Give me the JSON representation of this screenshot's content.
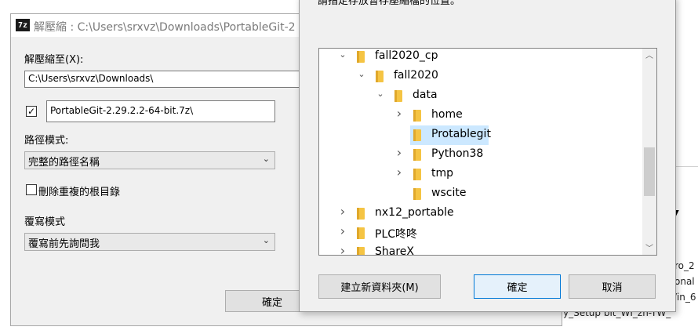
{
  "background": {
    "fragments": [
      "ro_2",
      "onal",
      "Vin_6",
      "y_Setup    bit_WI_zh-TW_"
    ]
  },
  "extract_dialog": {
    "logo": "7z",
    "title": "解壓縮 : C:\\Users\\srxvz\\Downloads\\PortableGit-2",
    "extract_to_label": "解壓縮至(X):",
    "extract_to_value": "C:\\Users\\srxvz\\Downloads\\",
    "subfolder_checked": true,
    "subfolder_value": "PortableGit-2.29.2.2-64-bit.7z\\",
    "path_mode_label": "路徑模式:",
    "path_mode_value": "完整的路徑名稱",
    "eliminate_duplicates_label": "刪除重複的根目錄",
    "eliminate_duplicates_checked": false,
    "overwrite_mode_label": "覆寫模式",
    "overwrite_mode_value": "覆寫前先詢問我",
    "ok_label": "確定"
  },
  "browse_dialog": {
    "instruction": "請指定存放暫存壓縮檔的位置。",
    "tree": [
      {
        "label": "fall2020_cp",
        "level": 1,
        "expander": "expanded",
        "selected": false
      },
      {
        "label": "fall2020",
        "level": 2,
        "expander": "expanded",
        "selected": false
      },
      {
        "label": "data",
        "level": 3,
        "expander": "expanded",
        "selected": false
      },
      {
        "label": "home",
        "level": 4,
        "expander": "collapsed",
        "selected": false
      },
      {
        "label": "Protablegit",
        "level": 4,
        "expander": "none",
        "selected": true
      },
      {
        "label": "Python38",
        "level": 4,
        "expander": "collapsed",
        "selected": false
      },
      {
        "label": "tmp",
        "level": 4,
        "expander": "collapsed",
        "selected": false
      },
      {
        "label": "wscite",
        "level": 4,
        "expander": "none",
        "selected": false
      },
      {
        "label": "nx12_portable",
        "level": 1,
        "expander": "collapsed",
        "selected": false
      },
      {
        "label": "PLC咚咚",
        "level": 1,
        "expander": "collapsed",
        "selected": false
      },
      {
        "label": "ShareX",
        "level": 1,
        "expander": "collapsed",
        "selected": false
      }
    ],
    "new_folder_label": "建立新資料夾(M)",
    "ok_label": "確定",
    "cancel_label": "取消"
  },
  "icons": {
    "expanded": "chevron-down-icon",
    "collapsed": "chevron-right-icon",
    "folder": "folder-icon",
    "scroll_up": "scroll-up-icon",
    "scroll_down": "scroll-down-icon",
    "dropdown": "chevron-down-icon"
  },
  "colors": {
    "selection": "#cce8ff",
    "folder": "#f5c443",
    "default_button_border": "#0078d7"
  }
}
